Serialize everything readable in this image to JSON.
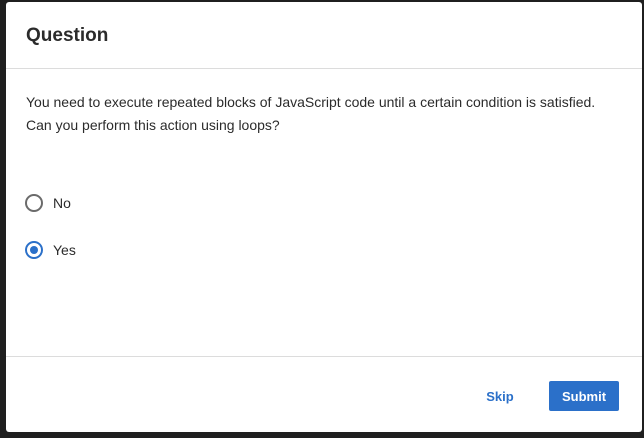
{
  "dialog": {
    "title": "Question",
    "question": "You need to execute repeated blocks of JavaScript code until a certain condition is satisfied. Can you perform this action using loops?",
    "options": [
      {
        "label": "No",
        "selected": false
      },
      {
        "label": "Yes",
        "selected": true
      }
    ],
    "skip_label": "Skip",
    "submit_label": "Submit"
  },
  "colors": {
    "accent": "#2b70c9",
    "text": "#2b2b2b",
    "backdrop": "#1f1f1f"
  }
}
